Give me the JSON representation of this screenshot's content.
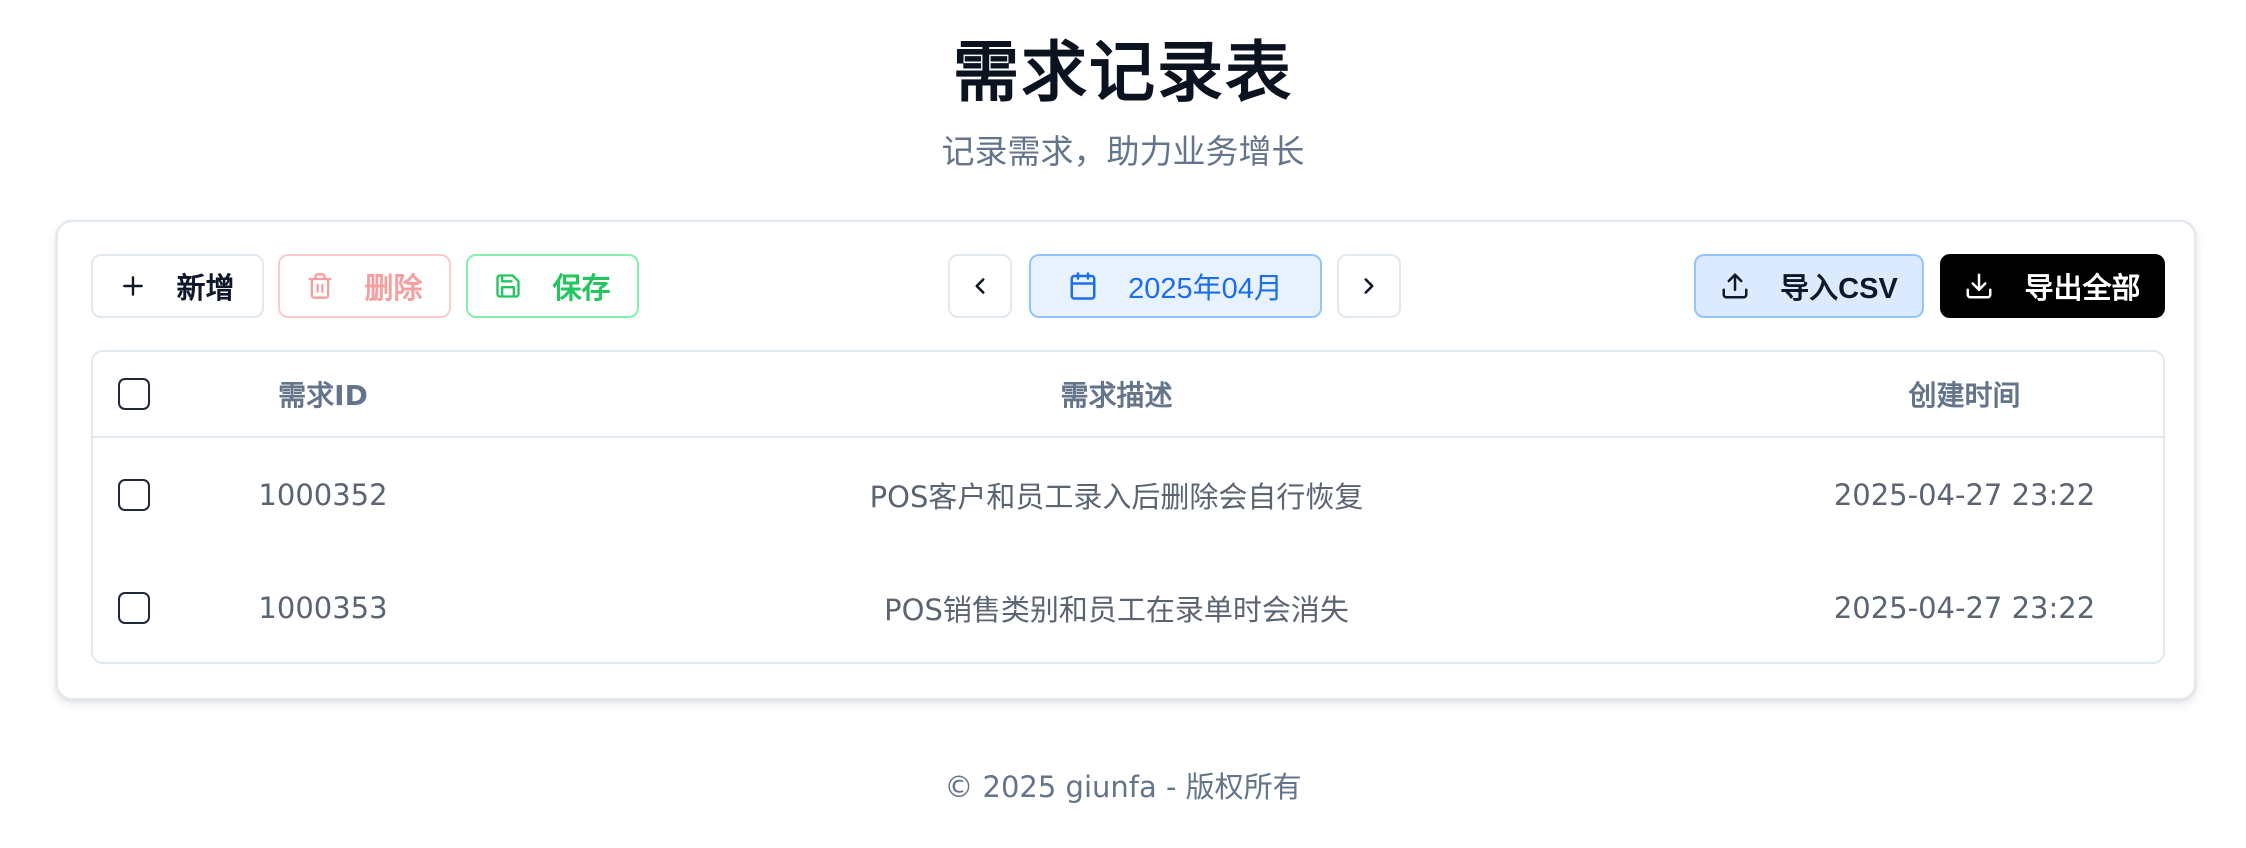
{
  "header": {
    "title": "需求记录表",
    "subtitle": "记录需求，助力业务增长"
  },
  "toolbar": {
    "add_label": "新增",
    "delete_label": "删除",
    "save_label": "保存",
    "month_label": "2025年04月",
    "import_label": "导入CSV",
    "export_label": "导出全部"
  },
  "table": {
    "columns": [
      "需求ID",
      "需求描述",
      "创建时间"
    ],
    "rows": [
      {
        "id": "1000352",
        "desc": "POS客户和员工录入后删除会自行恢复",
        "time": "2025-04-27 23:22"
      },
      {
        "id": "1000353",
        "desc": "POS销售类别和员工在录单时会消失",
        "time": "2025-04-27 23:22"
      }
    ]
  },
  "footer": {
    "text": "© 2025 giunfa - 版权所有"
  },
  "colors": {
    "accent_blue": "#1d6fe8",
    "save_green": "#22c55e",
    "delete_red": "#f4a0a0",
    "export_black": "#000000"
  },
  "icons": {
    "add": "plus-icon",
    "delete": "trash-icon",
    "save": "floppy-disk-icon",
    "prev": "chevron-left-icon",
    "month": "calendar-icon",
    "next": "chevron-right-icon",
    "import": "upload-icon",
    "export": "download-icon"
  }
}
